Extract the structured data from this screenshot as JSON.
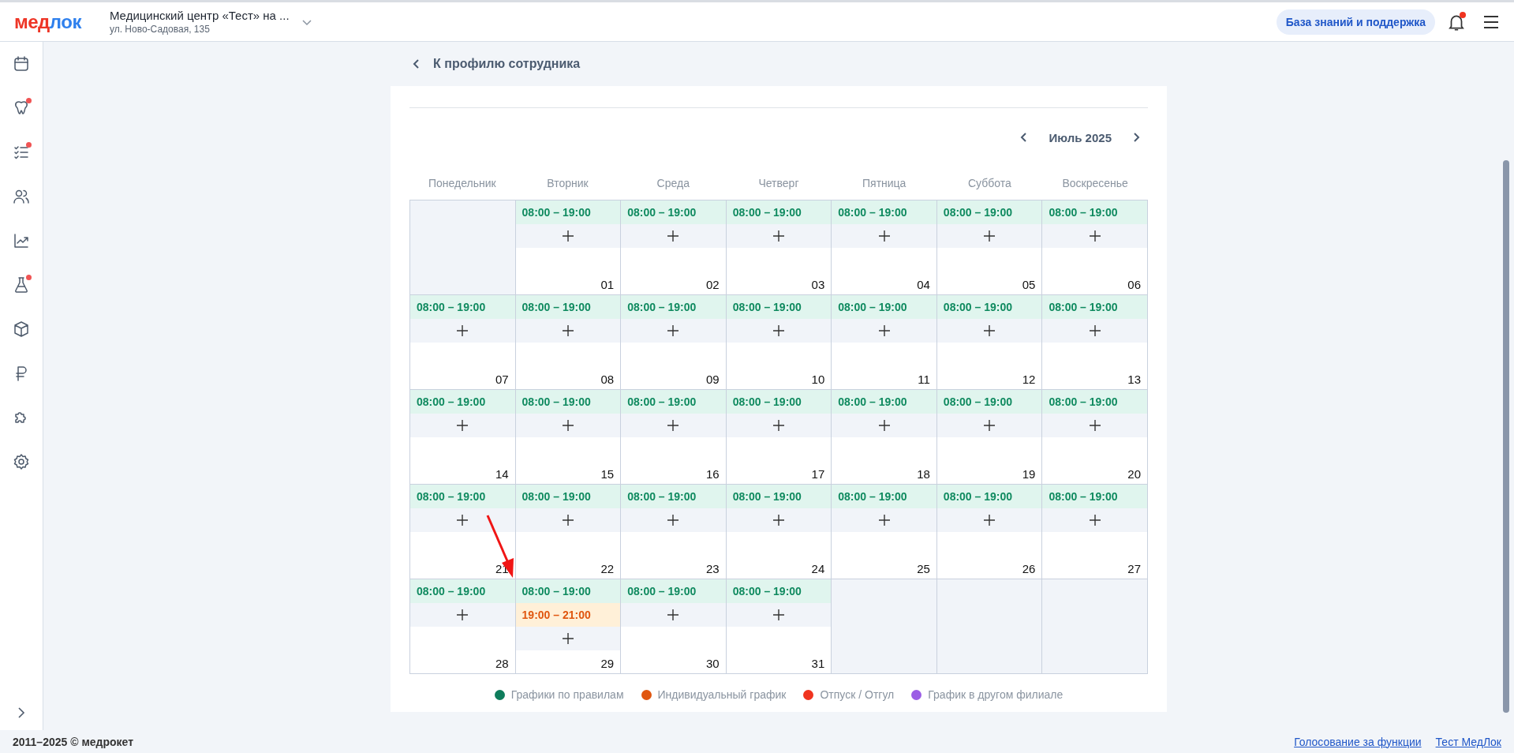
{
  "header": {
    "logo_parts": [
      "мед",
      "лок"
    ],
    "clinic": {
      "name": "Медицинский центр «Тест» на ...",
      "address": "ул. Ново-Садовая, 135"
    },
    "support_button": "База знаний и поддержка",
    "notifications": {
      "badge": true
    }
  },
  "sidebar": {
    "items": [
      {
        "badge": false
      },
      {
        "badge": true
      },
      {
        "badge": true
      },
      {
        "badge": false
      },
      {
        "badge": false
      },
      {
        "badge": true
      },
      {
        "badge": false
      },
      {
        "badge": false
      },
      {
        "badge": false
      },
      {
        "badge": false
      }
    ]
  },
  "back_link": "К профилю сотрудника",
  "calendar": {
    "month": "Июль 2025",
    "weekdays": [
      "Понедельник",
      "Вторник",
      "Среда",
      "Четверг",
      "Пятница",
      "Суббота",
      "Воскресенье"
    ],
    "weeks": [
      [
        {
          "kind": "blank"
        },
        {
          "kind": "day",
          "day": "01",
          "shifts": [
            {
              "kind": "rule",
              "time": "08:00 – 19:00"
            }
          ]
        },
        {
          "kind": "day",
          "day": "02",
          "shifts": [
            {
              "kind": "rule",
              "time": "08:00 – 19:00"
            }
          ]
        },
        {
          "kind": "day",
          "day": "03",
          "shifts": [
            {
              "kind": "rule",
              "time": "08:00 – 19:00"
            }
          ]
        },
        {
          "kind": "day",
          "day": "04",
          "shifts": [
            {
              "kind": "rule",
              "time": "08:00 – 19:00"
            }
          ]
        },
        {
          "kind": "day",
          "day": "05",
          "shifts": [
            {
              "kind": "rule",
              "time": "08:00 – 19:00"
            }
          ]
        },
        {
          "kind": "day",
          "day": "06",
          "shifts": [
            {
              "kind": "rule",
              "time": "08:00 – 19:00"
            }
          ]
        }
      ],
      [
        {
          "kind": "day",
          "day": "07",
          "shifts": [
            {
              "kind": "rule",
              "time": "08:00 – 19:00"
            }
          ]
        },
        {
          "kind": "day",
          "day": "08",
          "shifts": [
            {
              "kind": "rule",
              "time": "08:00 – 19:00"
            }
          ]
        },
        {
          "kind": "day",
          "day": "09",
          "shifts": [
            {
              "kind": "rule",
              "time": "08:00 – 19:00"
            }
          ]
        },
        {
          "kind": "day",
          "day": "10",
          "shifts": [
            {
              "kind": "rule",
              "time": "08:00 – 19:00"
            }
          ]
        },
        {
          "kind": "day",
          "day": "11",
          "shifts": [
            {
              "kind": "rule",
              "time": "08:00 – 19:00"
            }
          ]
        },
        {
          "kind": "day",
          "day": "12",
          "shifts": [
            {
              "kind": "rule",
              "time": "08:00 – 19:00"
            }
          ]
        },
        {
          "kind": "day",
          "day": "13",
          "shifts": [
            {
              "kind": "rule",
              "time": "08:00 – 19:00"
            }
          ]
        }
      ],
      [
        {
          "kind": "day",
          "day": "14",
          "shifts": [
            {
              "kind": "rule",
              "time": "08:00 – 19:00"
            }
          ]
        },
        {
          "kind": "day",
          "day": "15",
          "shifts": [
            {
              "kind": "rule",
              "time": "08:00 – 19:00"
            }
          ]
        },
        {
          "kind": "day",
          "day": "16",
          "shifts": [
            {
              "kind": "rule",
              "time": "08:00 – 19:00"
            }
          ]
        },
        {
          "kind": "day",
          "day": "17",
          "shifts": [
            {
              "kind": "rule",
              "time": "08:00 – 19:00"
            }
          ]
        },
        {
          "kind": "day",
          "day": "18",
          "shifts": [
            {
              "kind": "rule",
              "time": "08:00 – 19:00"
            }
          ]
        },
        {
          "kind": "day",
          "day": "19",
          "shifts": [
            {
              "kind": "rule",
              "time": "08:00 – 19:00"
            }
          ]
        },
        {
          "kind": "day",
          "day": "20",
          "shifts": [
            {
              "kind": "rule",
              "time": "08:00 – 19:00"
            }
          ]
        }
      ],
      [
        {
          "kind": "day",
          "day": "21",
          "shifts": [
            {
              "kind": "rule",
              "time": "08:00 – 19:00"
            }
          ]
        },
        {
          "kind": "day",
          "day": "22",
          "shifts": [
            {
              "kind": "rule",
              "time": "08:00 – 19:00"
            }
          ]
        },
        {
          "kind": "day",
          "day": "23",
          "shifts": [
            {
              "kind": "rule",
              "time": "08:00 – 19:00"
            }
          ]
        },
        {
          "kind": "day",
          "day": "24",
          "shifts": [
            {
              "kind": "rule",
              "time": "08:00 – 19:00"
            }
          ]
        },
        {
          "kind": "day",
          "day": "25",
          "shifts": [
            {
              "kind": "rule",
              "time": "08:00 – 19:00"
            }
          ]
        },
        {
          "kind": "day",
          "day": "26",
          "shifts": [
            {
              "kind": "rule",
              "time": "08:00 – 19:00"
            }
          ]
        },
        {
          "kind": "day",
          "day": "27",
          "shifts": [
            {
              "kind": "rule",
              "time": "08:00 – 19:00"
            }
          ]
        }
      ],
      [
        {
          "kind": "day",
          "day": "28",
          "shifts": [
            {
              "kind": "rule",
              "time": "08:00 – 19:00"
            }
          ]
        },
        {
          "kind": "day",
          "day": "29",
          "shifts": [
            {
              "kind": "rule",
              "time": "08:00 – 19:00"
            },
            {
              "kind": "individual",
              "time": "19:00 – 21:00"
            }
          ]
        },
        {
          "kind": "day",
          "day": "30",
          "shifts": [
            {
              "kind": "rule",
              "time": "08:00 – 19:00"
            }
          ]
        },
        {
          "kind": "day",
          "day": "31",
          "shifts": [
            {
              "kind": "rule",
              "time": "08:00 – 19:00"
            }
          ]
        },
        {
          "kind": "blank"
        },
        {
          "kind": "blank"
        },
        {
          "kind": "blank"
        }
      ]
    ],
    "legend": [
      {
        "label": "Графики по правилам",
        "color": "#0f7d5c"
      },
      {
        "label": "Индивидуальный график",
        "color": "#e0560f"
      },
      {
        "label": "Отпуск / Отгул",
        "color": "#f0341f"
      },
      {
        "label": "График в другом филиале",
        "color": "#9b5de5"
      }
    ]
  },
  "annotation": {
    "kind": "arrow"
  },
  "footer": {
    "copyright": "2011–2025 © медрокет",
    "links": [
      "Голосование за функции",
      "Тест МедЛок"
    ]
  }
}
